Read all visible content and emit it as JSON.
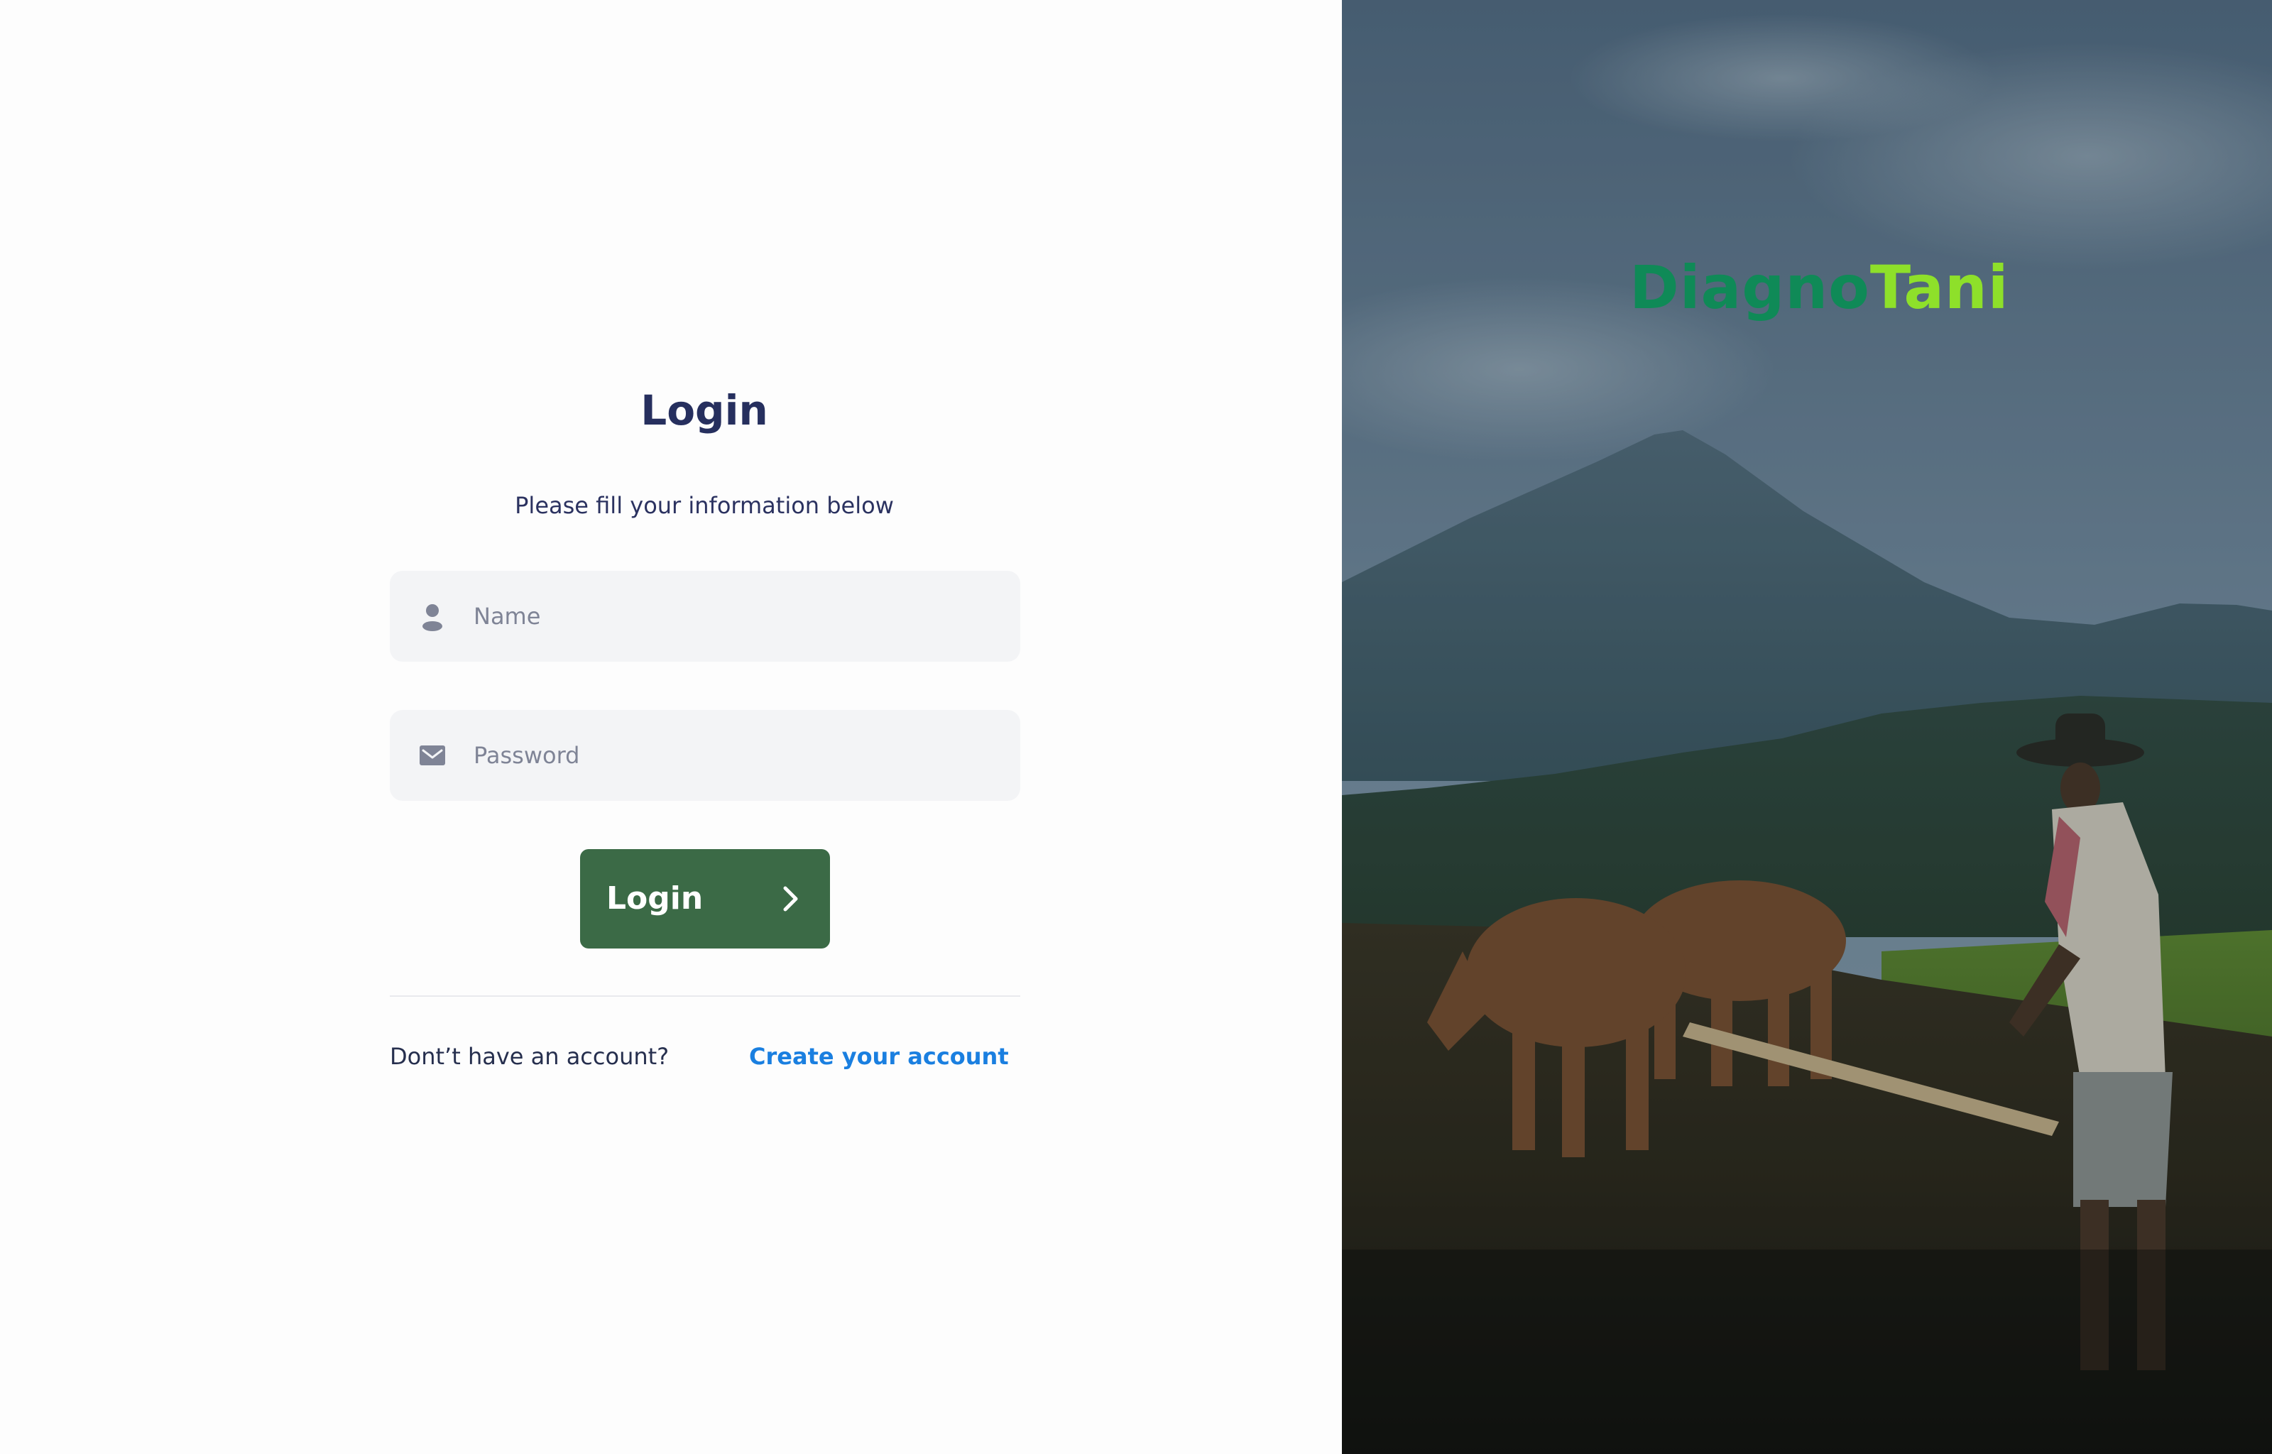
{
  "login_form": {
    "title": "Login",
    "subtitle": "Please fill your information below",
    "name_field": {
      "placeholder": "Name",
      "value": "",
      "icon": "user-icon"
    },
    "password_field": {
      "placeholder": "Password",
      "value": "",
      "icon": "mail-icon"
    },
    "submit": {
      "label": "Login",
      "icon": "chevron-right-icon"
    }
  },
  "signup_prompt": {
    "text": "Dont’t have an account?",
    "link_label": "Create your account"
  },
  "brand": {
    "part1": "Diagno",
    "part2": "Tani",
    "color_part1": "#0f8a57",
    "color_part2": "#8ee02a"
  },
  "colors": {
    "primary_button": "#3b6a46",
    "link": "#1a7fe0",
    "heading": "#262f5e",
    "input_bg": "#f3f4f6"
  }
}
